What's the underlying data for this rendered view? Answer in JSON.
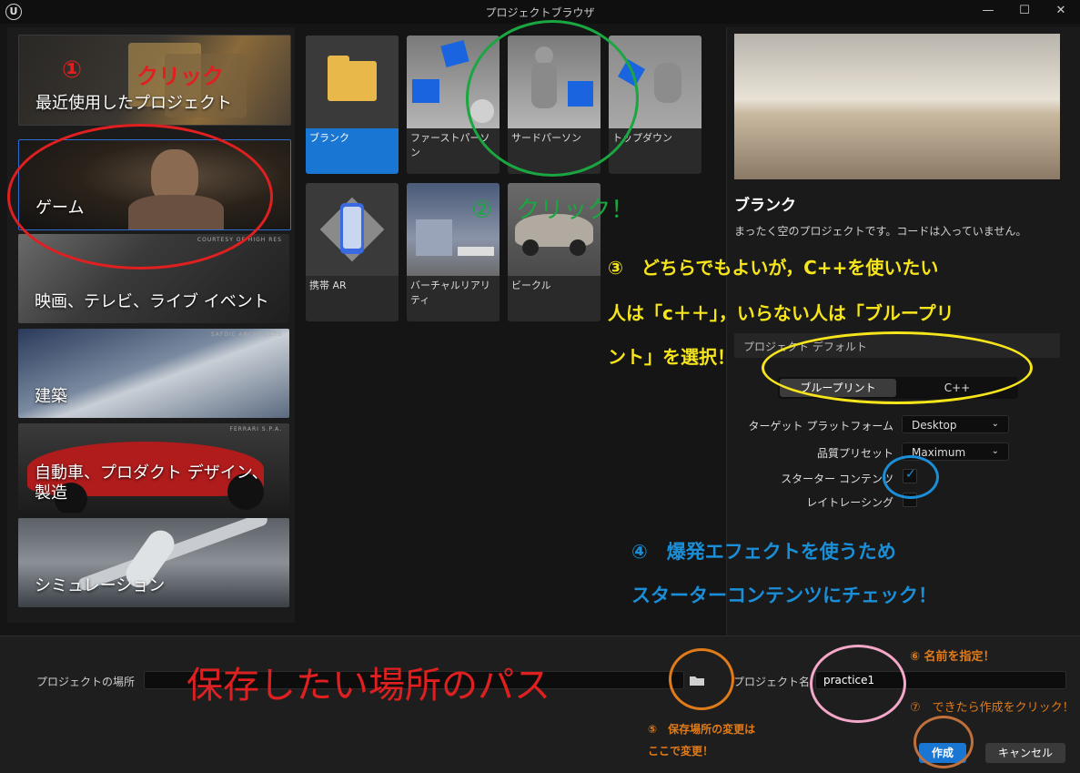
{
  "window": {
    "title": "プロジェクトブラウザ",
    "logo": "U",
    "minimize": "—",
    "maximize": "☐",
    "close": "✕"
  },
  "categories": [
    {
      "label": "最近使用したプロジェクト",
      "credit": ""
    },
    {
      "label": "ゲーム",
      "credit": ""
    },
    {
      "label": "映画、テレビ、ライブ イベント",
      "credit": "COURTESY OF HIGH RES"
    },
    {
      "label": "建築",
      "credit": "SAFDIE ARCHITECTS"
    },
    {
      "label": "自動車、プロダクト デザイン、製造",
      "credit": "FERRARI S.P.A."
    },
    {
      "label": "シミュレーション",
      "credit": ""
    }
  ],
  "templates": [
    {
      "label": "ブランク",
      "selected": true
    },
    {
      "label": "ファーストパーソン",
      "selected": false
    },
    {
      "label": "サードパーソン",
      "selected": false
    },
    {
      "label": "トップダウン",
      "selected": false
    },
    {
      "label": "携帯 AR",
      "selected": false
    },
    {
      "label": "バーチャルリアリティ",
      "selected": false
    },
    {
      "label": "ビークル",
      "selected": false
    }
  ],
  "details": {
    "name": "ブランク",
    "description": "まったく空のプロジェクトです。コードは入っていません。",
    "defaults_header": "プロジェクト デフォルト",
    "mode_blueprint": "ブループリント",
    "mode_cpp": "C++",
    "target_label": "ターゲット プラットフォーム",
    "target_value": "Desktop",
    "quality_label": "品質プリセット",
    "quality_value": "Maximum",
    "starter_label": "スターター コンテンツ",
    "starter_checked": true,
    "raytracing_label": "レイトレーシング",
    "raytracing_checked": false
  },
  "bottom": {
    "location_label": "プロジェクトの場所",
    "location_value": "",
    "name_label": "プロジェクト名",
    "name_value": "practice1",
    "create_label": "作成",
    "cancel_label": "キャンセル"
  },
  "annotations": {
    "a1_num": "①",
    "a1_text": "クリック",
    "a2": "②　クリック！",
    "a3_line1": "③　どちらでもよいが，C++を使いたい",
    "a3_line2": "人は「c＋＋」，いらない人は「ブループリ",
    "a3_line3": "ント」を選択！",
    "a4_line1": "④　爆発エフェクトを使うため",
    "a4_line2": "スターターコンテンツにチェック！",
    "path_note": "保存したい場所のパス",
    "a5_line1": "⑤　保存場所の変更は",
    "a5_line2": "ここで変更！",
    "a6": "⑥ 名前を指定！",
    "a7": "⑦　できたら作成をクリック！"
  },
  "colors": {
    "accent": "#1976d2",
    "red": "#e02020",
    "green": "#1aa640",
    "yellow": "#f5e51a",
    "blue": "#1a8fd8",
    "orange": "#e07b1a",
    "pink": "#f4a7c8",
    "brown": "#c0703a"
  }
}
